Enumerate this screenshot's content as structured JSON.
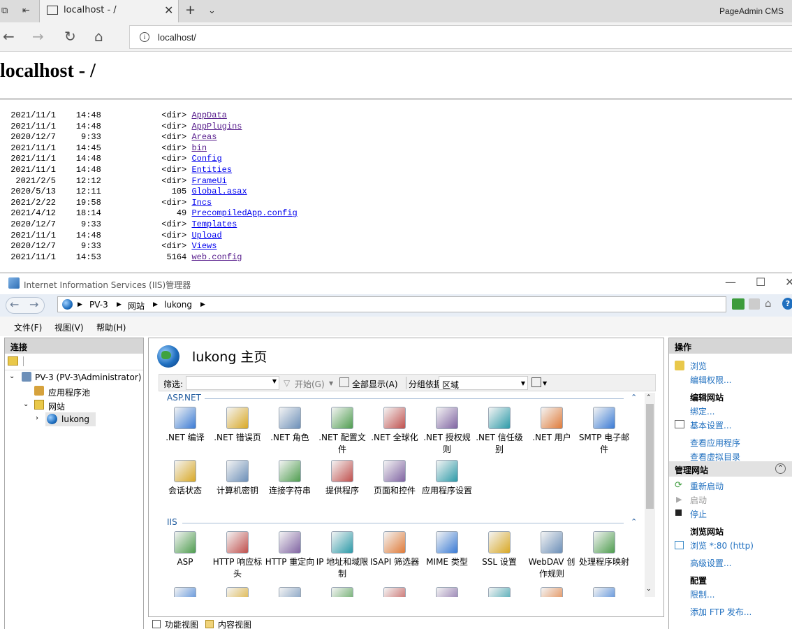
{
  "browser": {
    "tab_title": "localhost - /",
    "profile_label": "PageAdmin CMS",
    "url": "localhost/"
  },
  "listing": {
    "heading": "localhost - /",
    "rows": [
      {
        "date": "2021/11/1",
        "time": "14:48",
        "size": "<dir>",
        "name": "AppData",
        "visited": true
      },
      {
        "date": "2021/11/1",
        "time": "14:48",
        "size": "<dir>",
        "name": "AppPlugins",
        "visited": true
      },
      {
        "date": "2020/12/7",
        "time": "9:33",
        "size": "<dir>",
        "name": "Areas",
        "visited": true
      },
      {
        "date": "2021/11/1",
        "time": "14:45",
        "size": "<dir>",
        "name": "bin",
        "visited": true
      },
      {
        "date": "2021/11/1",
        "time": "14:48",
        "size": "<dir>",
        "name": "Config",
        "visited": false
      },
      {
        "date": "2021/11/1",
        "time": "14:48",
        "size": "<dir>",
        "name": "Entities",
        "visited": false
      },
      {
        "date": "2021/2/5",
        "time": "12:12",
        "size": "<dir>",
        "name": "FrameUi",
        "visited": false
      },
      {
        "date": "2020/5/13",
        "time": "12:11",
        "size": "105",
        "name": "Global.asax",
        "visited": false
      },
      {
        "date": "2021/2/22",
        "time": "19:58",
        "size": "<dir>",
        "name": "Incs",
        "visited": false
      },
      {
        "date": "2021/4/12",
        "time": "18:14",
        "size": "49",
        "name": "PrecompiledApp.config",
        "visited": false
      },
      {
        "date": "2020/12/7",
        "time": "9:33",
        "size": "<dir>",
        "name": "Templates",
        "visited": false
      },
      {
        "date": "2021/11/1",
        "time": "14:48",
        "size": "<dir>",
        "name": "Upload",
        "visited": false
      },
      {
        "date": "2020/12/7",
        "time": "9:33",
        "size": "<dir>",
        "name": "Views",
        "visited": false
      },
      {
        "date": "2021/11/1",
        "time": "14:53",
        "size": "5164",
        "name": "web.config",
        "visited": true
      }
    ]
  },
  "iis": {
    "window_title": "Internet Information Services (IIS)管理器",
    "breadcrumb": [
      "PV-3",
      "网站",
      "lukong"
    ],
    "menu": [
      "文件(F)",
      "视图(V)",
      "帮助(H)"
    ],
    "connections": {
      "header": "连接",
      "server": "PV-3 (PV-3\\Administrator)",
      "app_pools": "应用程序池",
      "sites": "网站",
      "site": "lukong"
    },
    "center": {
      "title": "lukong 主页",
      "filter_label": "筛选:",
      "start_label": "开始(G)",
      "show_all_label": "全部显示(A)",
      "group_by_label": "分组依据:",
      "group_by_value": "区域",
      "sections": [
        {
          "name": "ASP.NET",
          "items": [
            ".NET 编译",
            ".NET 错误页",
            ".NET 角色",
            ".NET 配置文件",
            ".NET 全球化",
            ".NET 授权规则",
            ".NET 信任级别",
            ".NET 用户",
            "SMTP 电子邮件",
            "会话状态",
            "计算机密钥",
            "连接字符串",
            "提供程序",
            "页面和控件",
            "应用程序设置"
          ]
        },
        {
          "name": "IIS",
          "items": [
            "ASP",
            "HTTP 响应标头",
            "HTTP 重定向",
            "IP 地址和域限制",
            "ISAPI 筛选器",
            "MIME 类型",
            "SSL 设置",
            "WebDAV 创作规则",
            "处理程序映射"
          ]
        }
      ],
      "bottom_tabs": [
        "功能视图",
        "内容视图"
      ]
    },
    "actions": {
      "header": "操作",
      "browse": "浏览",
      "edit_permissions": "编辑权限...",
      "edit_site_header": "编辑网站",
      "bindings": "绑定...",
      "basic_settings": "基本设置...",
      "view_apps": "查看应用程序",
      "view_vdirs": "查看虚拟目录",
      "manage_site_header": "管理网站",
      "restart": "重新启动",
      "start": "启动",
      "stop": "停止",
      "browse_site_header": "浏览网站",
      "browse_80": "浏览 *:80 (http)",
      "advanced_settings": "高级设置...",
      "config_header": "配置",
      "limits": "限制...",
      "add_ftp": "添加 FTP 发布..."
    }
  }
}
